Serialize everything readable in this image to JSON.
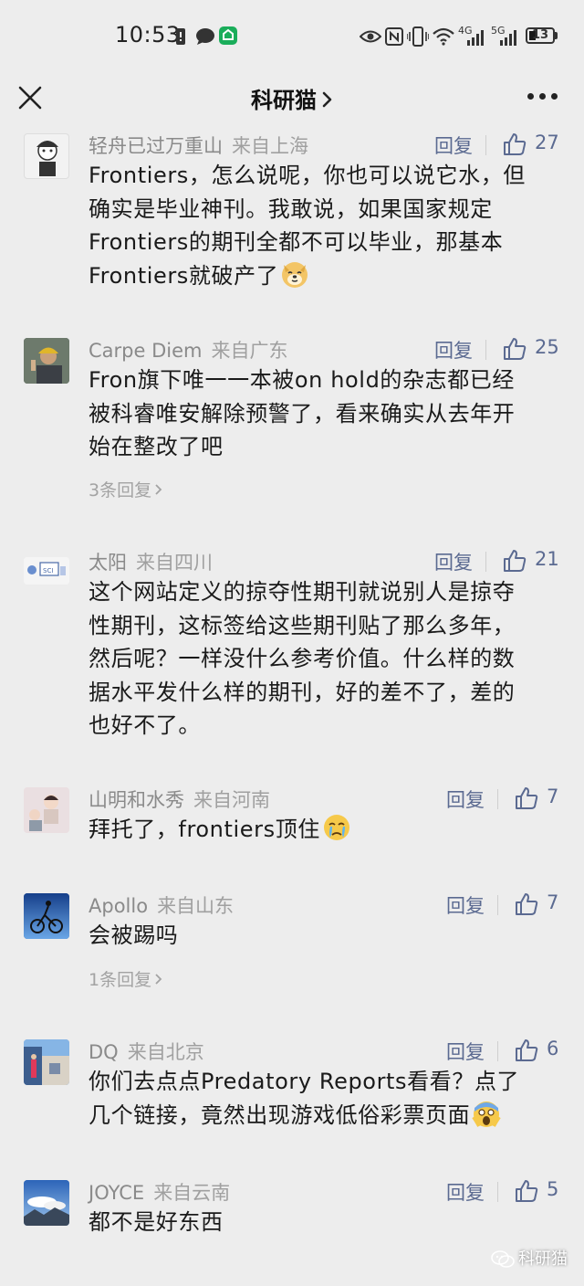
{
  "status_bar": {
    "time": "10:53",
    "net_a": "4G",
    "net_b": "5G",
    "battery": "13",
    "icons": [
      "alarm-icon",
      "message-icon",
      "app-notification-icon",
      "eye-icon",
      "nfc-icon",
      "vibrate-icon",
      "wifi-icon",
      "signal-icon",
      "signal-icon",
      "battery-icon"
    ]
  },
  "nav": {
    "title": "科研猫",
    "icons": [
      "close-icon",
      "chevron-right-icon",
      "more-icon"
    ]
  },
  "colors": {
    "background": "#ededed",
    "link": "#5b6a91",
    "secondary_text": "#8a8a8a",
    "body_text": "#1a1a1a"
  },
  "comments": [
    {
      "author": "轻舟已过万重山",
      "location": "来自上海",
      "reply_label": "回复",
      "likes": "27",
      "lines": [
        "Frontiers，怎么说呢，你也可以说它水，但",
        "确实是毕业神刊。我敢说，如果国家规定",
        "Frontiers的期刊全都不可以毕业，那基本",
        "Frontiers就破产了"
      ],
      "emoji": "doge-emoji"
    },
    {
      "author": "Carpe Diem",
      "location": "来自广东",
      "reply_label": "回复",
      "likes": "25",
      "lines": [
        "Fron旗下唯一一本被on hold的杂志都已经",
        "被科睿唯安解除预警了，看来确实从去年开",
        "始在整改了吧"
      ],
      "more_replies": "3条回复"
    },
    {
      "author": "太阳",
      "location": "来自四川",
      "reply_label": "回复",
      "likes": "21",
      "lines": [
        "这个网站定义的掠夺性期刊就说别人是掠夺",
        "性期刊，这标签给这些期刊贴了那么多年，",
        "然后呢？一样没什么参考价值。什么样的数",
        "据水平发什么样的期刊，好的差不了，差的",
        "也好不了。"
      ]
    },
    {
      "author": "山明和水秀",
      "location": "来自河南",
      "reply_label": "回复",
      "likes": "7",
      "lines": [
        "拜托了，frontiers顶住"
      ],
      "emoji": "crying-emoji"
    },
    {
      "author": "Apollo",
      "location": "来自山东",
      "reply_label": "回复",
      "likes": "7",
      "lines": [
        "会被踢吗"
      ],
      "more_replies": "1条回复"
    },
    {
      "author": "DQ",
      "location": "来自北京",
      "reply_label": "回复",
      "likes": "6",
      "lines": [
        "你们去点点Predatory Reports看看？点了",
        "几个链接，竟然出现游戏低俗彩票页面"
      ],
      "emoji": "scream-emoji"
    },
    {
      "author": "JOYCE",
      "location": "来自云南",
      "reply_label": "回复",
      "likes": "5",
      "lines": [
        "都不是好东西"
      ]
    }
  ],
  "watermark": {
    "text": "科研猫",
    "icon": "wechat-icon"
  }
}
